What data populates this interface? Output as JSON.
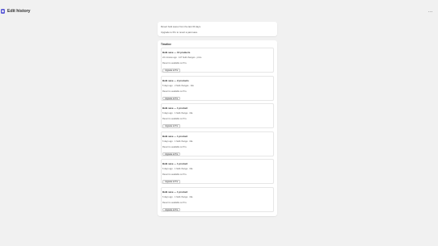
{
  "header": {
    "app_icon": "app-logo-icon",
    "title": "Edit history",
    "more_label": "..."
  },
  "notice": {
    "text": "Revert bulk saves from the last 30 days.",
    "upgrade_text": "Upgrade to Pro to revert a past save."
  },
  "timeline": {
    "title": "Timeline",
    "entries": [
      {
        "title": "Bulk save — 10 products",
        "meta": "22 minutes ago · 127 field changes · price",
        "revert_text": "Revert is available on Pro.",
        "button_label": "Upgrade to Pro"
      },
      {
        "title": "Bulk save — 2 products",
        "meta": "5 days ago · 2 field changes · title",
        "revert_text": "Revert is available on Pro.",
        "button_label": "Upgrade to Pro"
      },
      {
        "title": "Bulk save — 1 product",
        "meta": "6 days ago · 1 field change · title",
        "revert_text": "Revert is available on Pro.",
        "button_label": "Upgrade to Pro"
      },
      {
        "title": "Bulk save — 1 product",
        "meta": "6 days ago · 1 field change · title",
        "revert_text": "Revert is available on Pro.",
        "button_label": "Upgrade to Pro"
      },
      {
        "title": "Bulk save — 1 product",
        "meta": "6 days ago · 1 field change · title",
        "revert_text": "Revert is available on Pro.",
        "button_label": "Upgrade to Pro"
      },
      {
        "title": "Bulk save — 1 product",
        "meta": "6 days ago · 1 field change · title",
        "revert_text": "Revert is available on Pro.",
        "button_label": "Upgrade to Pro"
      }
    ]
  },
  "colors": {
    "background": "#f1f1f1",
    "card": "#ffffff",
    "accent": "#5b5bd6",
    "text": "#303030"
  }
}
